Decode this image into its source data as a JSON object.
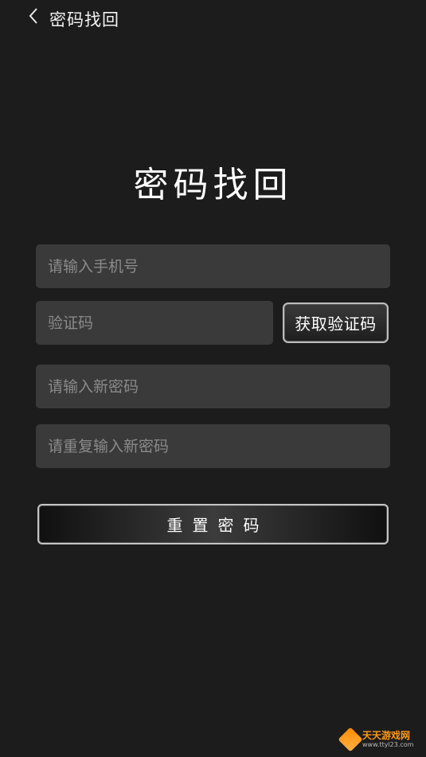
{
  "header": {
    "title": "密码找回",
    "back_icon": "chevron-left-icon"
  },
  "main": {
    "heading": "密码找回",
    "phone_placeholder": "请输入手机号",
    "code_placeholder": "验证码",
    "get_code_label": "获取验证码",
    "new_password_placeholder": "请输入新密码",
    "repeat_password_placeholder": "请重复输入新密码",
    "reset_label": "重置密码"
  },
  "watermark": {
    "name": "天天游戏网",
    "url": "www.ttyl23.com"
  },
  "colors": {
    "background": "#1c1c1c",
    "field": "#3a3a3a",
    "placeholder": "#8a8a8a",
    "watermark_accent": "#ff9a1a"
  }
}
